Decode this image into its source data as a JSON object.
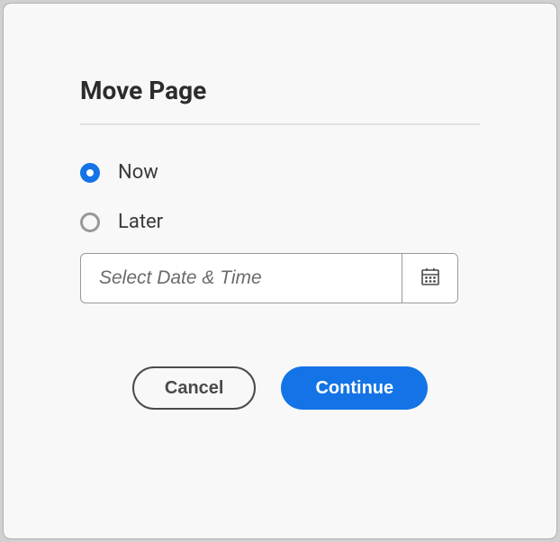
{
  "dialog": {
    "title": "Move Page",
    "options": {
      "now": {
        "label": "Now",
        "selected": true
      },
      "later": {
        "label": "Later",
        "selected": false
      }
    },
    "datetime": {
      "placeholder": "Select Date & Time",
      "value": ""
    },
    "buttons": {
      "cancel": "Cancel",
      "continue": "Continue"
    }
  },
  "colors": {
    "accent": "#1473e6"
  }
}
